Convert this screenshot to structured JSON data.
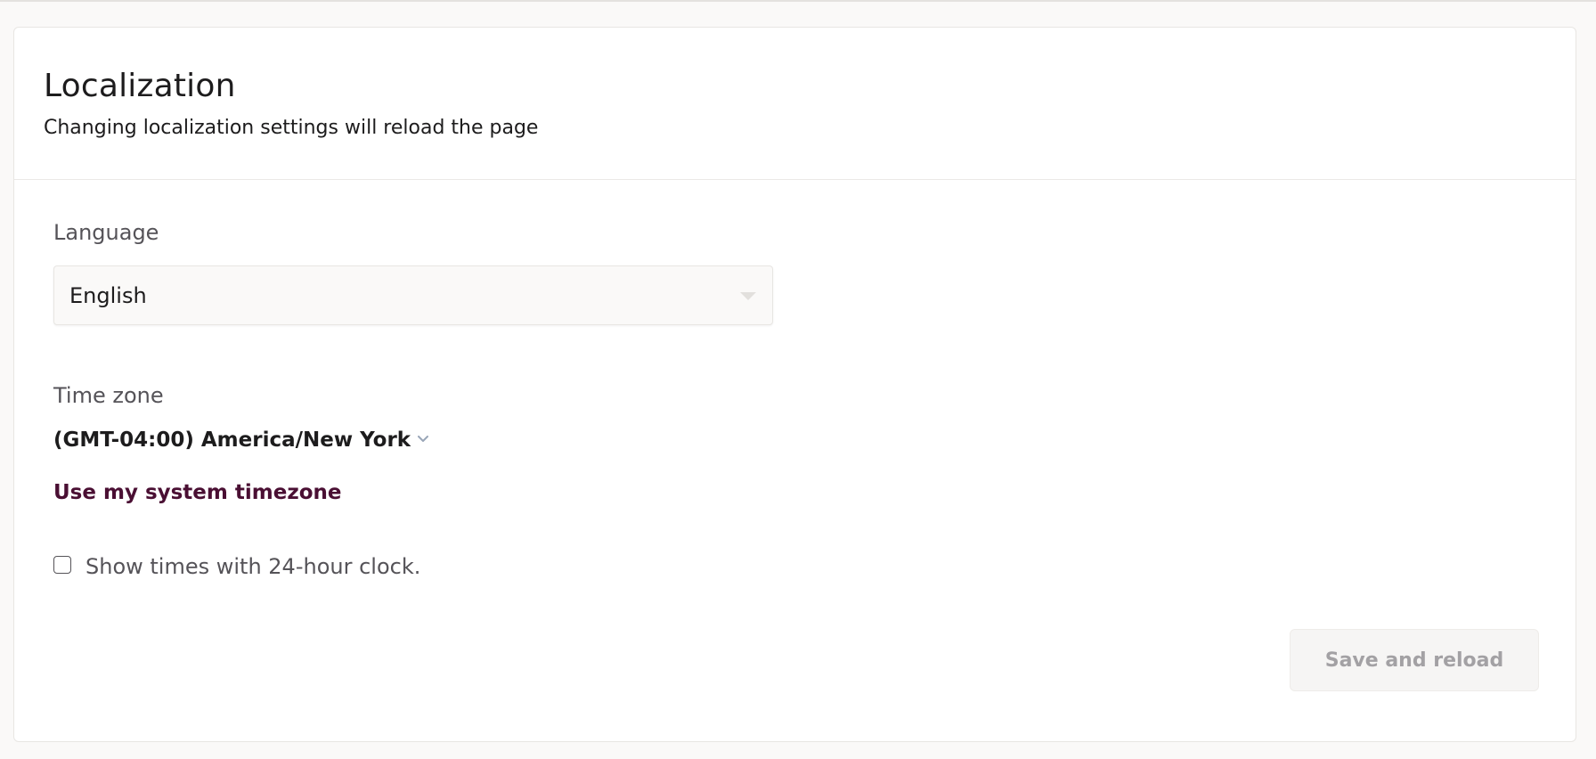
{
  "panel": {
    "title": "Localization",
    "subtitle": "Changing localization settings will reload the page"
  },
  "language": {
    "label": "Language",
    "selected": "English"
  },
  "timezone": {
    "label": "Time zone",
    "selected": "(GMT-04:00) America/New York",
    "system_link": "Use my system timezone"
  },
  "clock": {
    "label": "Show times with 24-hour clock.",
    "checked": false
  },
  "actions": {
    "save_label": "Save and reload"
  },
  "icons": {
    "language_caret": "chevron-down-icon",
    "timezone_caret": "chevron-down-icon"
  },
  "colors": {
    "link": "#4a0f33",
    "text": "#1d1c1d",
    "muted": "#555358",
    "disabled_text": "#a3a1a4"
  }
}
